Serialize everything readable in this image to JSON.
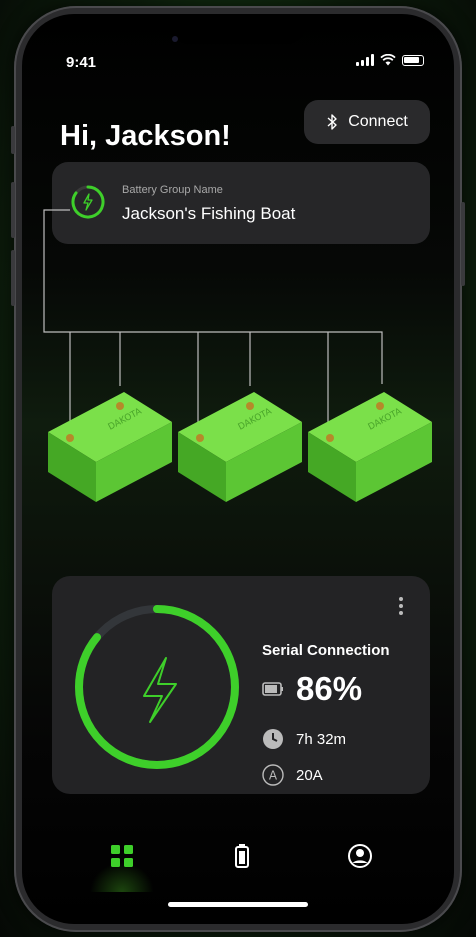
{
  "status_bar": {
    "time": "9:41"
  },
  "header": {
    "greeting": "Hi, Jackson!",
    "connect_label": "Connect"
  },
  "battery_group": {
    "label": "Battery Group Name",
    "name": "Jackson's Fishing Boat"
  },
  "batteries": [
    {
      "brand": "DAKOTA"
    },
    {
      "brand": "DAKOTA"
    },
    {
      "brand": "DAKOTA"
    }
  ],
  "status": {
    "connection_type": "Serial Connection",
    "charge_percent_text": "86%",
    "charge_percent": 86,
    "time_remaining": "7h 32m",
    "current": "20A"
  },
  "colors": {
    "accent": "#3ecf2a",
    "card": "#262628",
    "battery_green": "#5fd631"
  },
  "tabs": [
    {
      "icon": "dashboard-grid-icon",
      "active": true
    },
    {
      "icon": "battery-icon",
      "active": false
    },
    {
      "icon": "profile-icon",
      "active": false
    }
  ]
}
